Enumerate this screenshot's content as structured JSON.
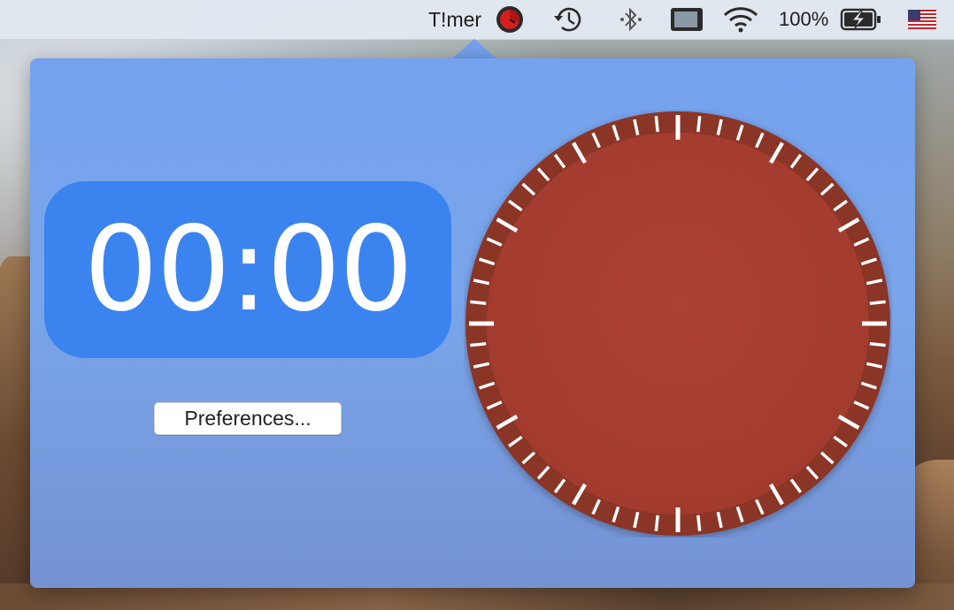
{
  "menubar": {
    "app_title": "T!mer",
    "battery_percent": "100%",
    "icons": [
      "timer-dial-icon",
      "time-machine-icon",
      "bluetooth-icon",
      "display-icon",
      "wifi-icon",
      "battery-charging-icon",
      "us-flag-icon"
    ]
  },
  "timer": {
    "display": "00:00",
    "preferences_label": "Preferences...",
    "dial_minute_ticks": 60
  },
  "colors": {
    "popover_bg": "#74a2ee",
    "time_pill": "#3b84f0",
    "dial_ring": "#8b3428",
    "dial_face": "#aa3f32",
    "tick": "#ffffff"
  }
}
